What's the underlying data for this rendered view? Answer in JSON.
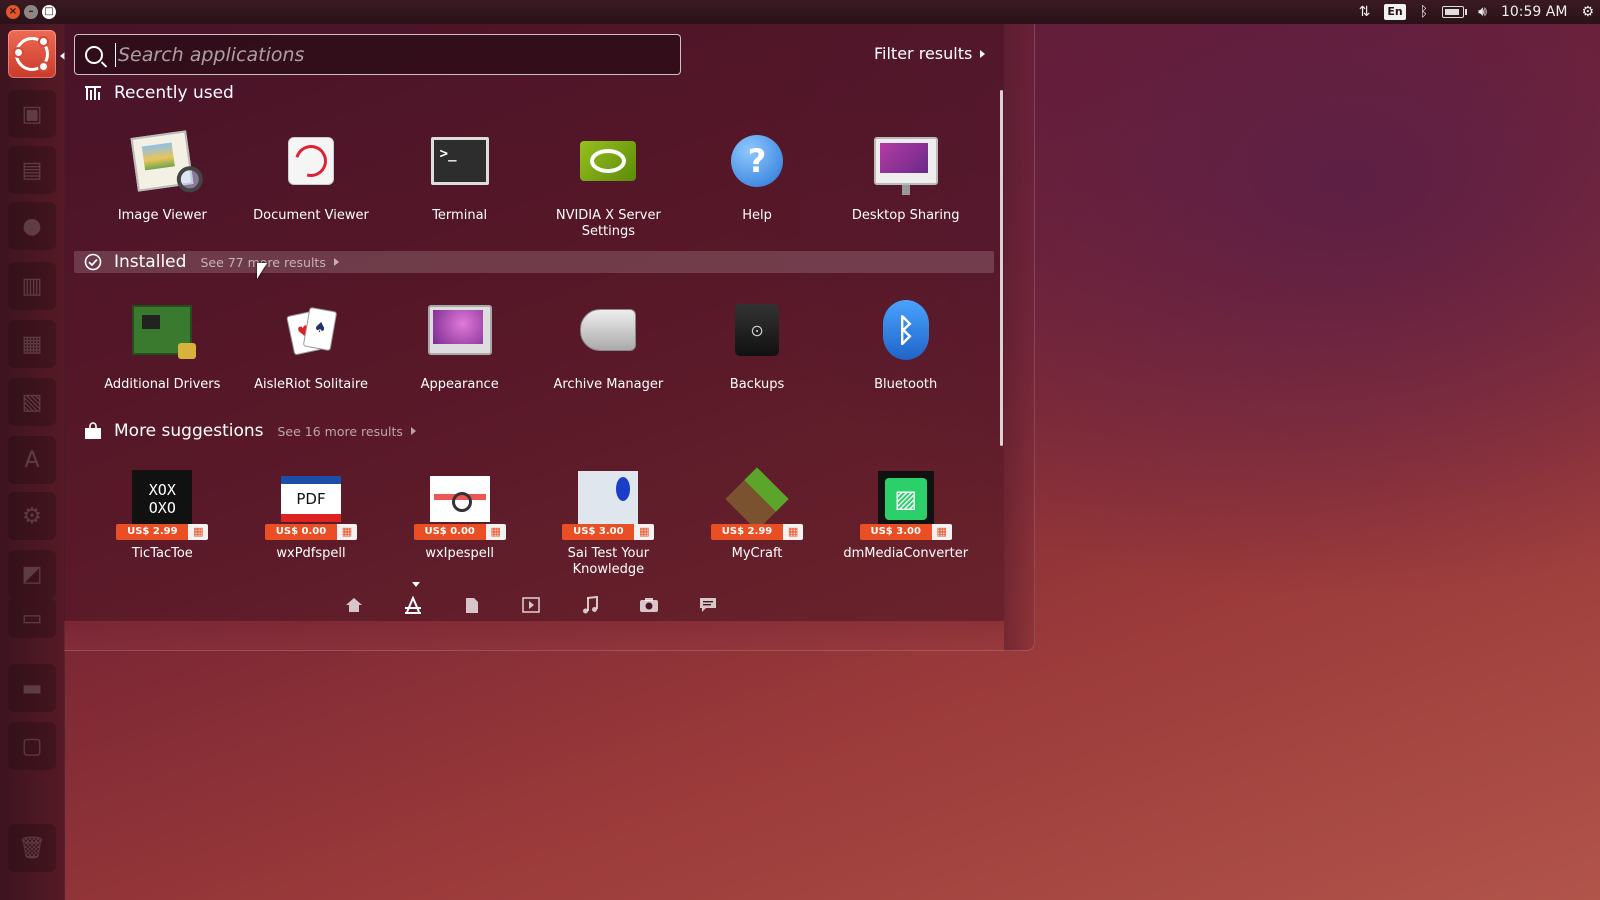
{
  "panel": {
    "window_buttons": [
      "×",
      "–",
      "□"
    ],
    "keyboard_layout": "En",
    "clock": "10:59 AM"
  },
  "launcher": {
    "items": [
      "ubuntu-logo-icon",
      "lock-icon",
      "files-icon",
      "browser-icon",
      "writer-icon",
      "calc-icon",
      "impress-icon",
      "software-center-icon",
      "settings-icon",
      "workspace-icon",
      "drive-icon",
      "drive-2-icon",
      "window-icon",
      "trash-icon"
    ]
  },
  "search": {
    "placeholder": "Search applications",
    "value": ""
  },
  "filter": {
    "label": "Filter results"
  },
  "categories": {
    "recent": {
      "title": "Recently used",
      "apps": [
        {
          "label": "Image Viewer",
          "icon": "image-viewer-icon"
        },
        {
          "label": "Document Viewer",
          "icon": "document-viewer-icon"
        },
        {
          "label": "Terminal",
          "icon": "terminal-icon"
        },
        {
          "label": "NVIDIA X Server Settings",
          "icon": "nvidia-icon"
        },
        {
          "label": "Help",
          "icon": "help-icon"
        },
        {
          "label": "Desktop Sharing",
          "icon": "desktop-sharing-icon"
        }
      ]
    },
    "installed": {
      "title": "Installed",
      "more": "See 77 more results",
      "apps": [
        {
          "label": "Additional Drivers",
          "icon": "additional-drivers-icon"
        },
        {
          "label": "AisleRiot Solitaire",
          "icon": "solitaire-icon"
        },
        {
          "label": "Appearance",
          "icon": "appearance-icon"
        },
        {
          "label": "Archive Manager",
          "icon": "archive-manager-icon"
        },
        {
          "label": "Backups",
          "icon": "backups-icon"
        },
        {
          "label": "Bluetooth",
          "icon": "bluetooth-icon"
        }
      ]
    },
    "suggestions": {
      "title": "More suggestions",
      "more": "See 16 more results",
      "apps": [
        {
          "label": "TicTacToe",
          "price": "US$ 2.99",
          "icon": "tictactoe-icon"
        },
        {
          "label": "wxPdfspell",
          "price": "US$ 0.00",
          "icon": "wxpdfspell-icon"
        },
        {
          "label": "wxIpespell",
          "price": "US$ 0.00",
          "icon": "wxipespell-icon"
        },
        {
          "label": "Sai Test Your Knowledge",
          "price": "US$ 3.00",
          "icon": "sai-test-icon"
        },
        {
          "label": "MyCraft",
          "price": "US$ 2.99",
          "icon": "mycraft-icon"
        },
        {
          "label": "dmMediaConverter",
          "price": "US$ 3.00",
          "icon": "dmmediaconverter-icon"
        }
      ]
    }
  },
  "icon_glyphs": {
    "terminal": ">_",
    "help": "?",
    "bluetooth": "ᛒ",
    "backups": "⊙",
    "pdf": "PDF",
    "tictactoe": "XOX\nOXO",
    "dmmedia": "▨",
    "gift": "▦",
    "solitaire_a": "♥",
    "solitaire_b": "♠"
  },
  "lenses": [
    "home-lens-icon",
    "applications-lens-icon",
    "files-lens-icon",
    "video-lens-icon",
    "music-lens-icon",
    "photos-lens-icon",
    "social-lens-icon"
  ],
  "colors": {
    "accent": "#e94e24",
    "launcher_active": "#d84a36"
  }
}
